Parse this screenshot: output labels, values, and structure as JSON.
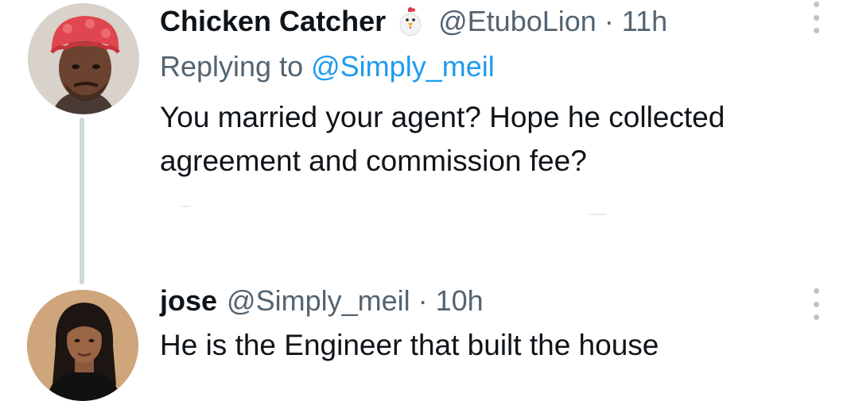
{
  "thread": {
    "tweets": [
      {
        "display_name": "Chicken Catcher",
        "name_emoji": "chicken-emoji",
        "handle": "@EtuboLion",
        "separator": "·",
        "time": "11h",
        "replying_prefix": "Replying to",
        "replying_to": "@Simply_meil",
        "text_lines": [
          "You married your agent? Hope he collected",
          "agreement and commission fee?"
        ]
      },
      {
        "display_name": "jose",
        "handle": "@Simply_meil",
        "separator": "·",
        "time": "10h",
        "text_lines": [
          "He is the Engineer that built the house"
        ]
      }
    ]
  },
  "colors": {
    "primary_text": "#0f1419",
    "secondary_text": "#536471",
    "link": "#1d9bf0",
    "thread_line": "#cfd9de",
    "more_dots": "#b9c4cc"
  },
  "icons": {
    "more": "vertical-ellipsis-icon",
    "emoji": "chicken-emoji-icon"
  }
}
